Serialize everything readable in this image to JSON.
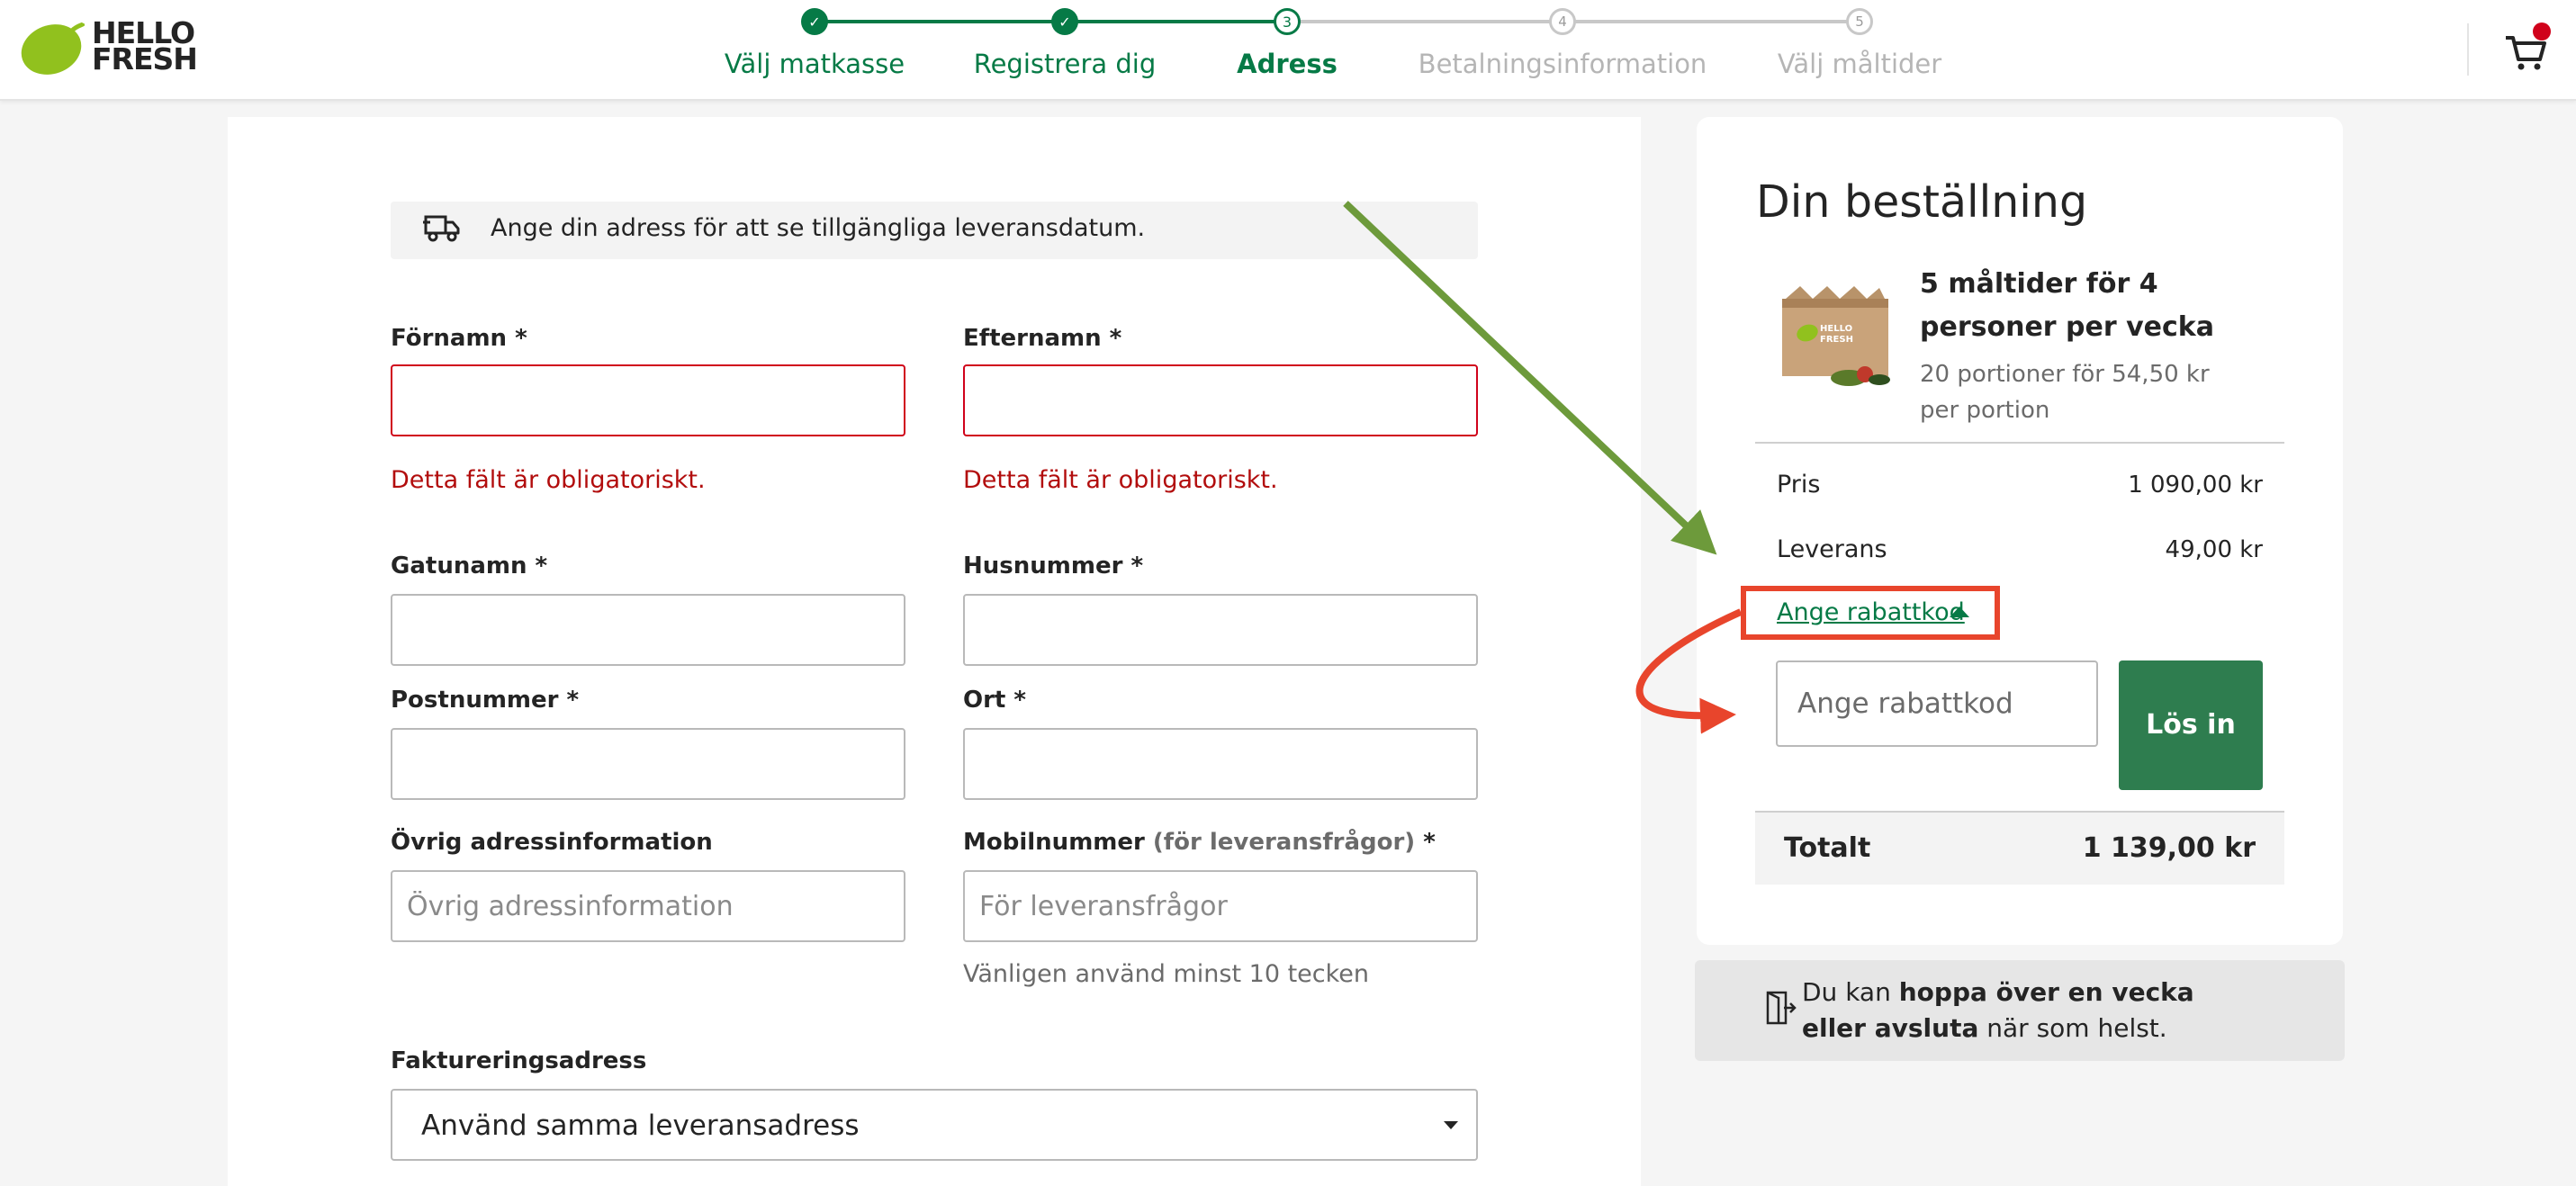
{
  "header": {
    "logo_text_line1": "HELLO",
    "logo_text_line2": "FRESH",
    "steps": [
      {
        "number": "1",
        "label": "Välj matkasse",
        "state": "done"
      },
      {
        "number": "2",
        "label": "Registrera dig",
        "state": "done"
      },
      {
        "number": "3",
        "label": "Adress",
        "state": "current"
      },
      {
        "number": "4",
        "label": "Betalningsinformation",
        "state": "todo"
      },
      {
        "number": "5",
        "label": "Välj måltider",
        "state": "todo"
      }
    ],
    "cart_icon": "cart-icon",
    "cart_has_notification": true
  },
  "form": {
    "banner_text": "Ange din adress för att se tillgängliga leveransdatum.",
    "first_name": {
      "label": "Förnamn *",
      "value": "",
      "error": "Detta fält är obligatoriskt."
    },
    "last_name": {
      "label": "Efternamn *",
      "value": "",
      "error": "Detta fält är obligatoriskt."
    },
    "street": {
      "label": "Gatunamn *",
      "value": ""
    },
    "house_number": {
      "label": "Husnummer *",
      "value": ""
    },
    "postal_code": {
      "label": "Postnummer *",
      "value": ""
    },
    "city": {
      "label": "Ort *",
      "value": ""
    },
    "other_address": {
      "label": "Övrig adressinformation",
      "placeholder": "Övrig adressinformation",
      "value": ""
    },
    "mobile": {
      "label": "Mobilnummer",
      "label_note": "(för leveransfrågor)",
      "label_required": " *",
      "placeholder": "För leveransfrågor",
      "hint": "Vänligen använd minst 10 tecken",
      "value": ""
    },
    "billing": {
      "label": "Faktureringsadress",
      "selected": "Använd samma leveransadress"
    }
  },
  "order": {
    "title": "Din beställning",
    "product_name": "5 måltider för 4 personer per vecka",
    "product_sub": "20 portioner för 54,50 kr per portion",
    "price_label": "Pris",
    "price_value": "1 090,00 kr",
    "delivery_label": "Leverans",
    "delivery_value": "49,00 kr",
    "promo_link": "Ange rabattkod",
    "promo_placeholder": "Ange rabattkod",
    "redeem_label": "Lös in",
    "total_label": "Totalt",
    "total_value": "1 139,00 kr"
  },
  "skip_info": {
    "prefix": "Du kan ",
    "bold1": "hoppa över en vecka eller avsluta",
    "suffix": " när som helst."
  },
  "colors": {
    "brand_green": "#067a46",
    "logo_green": "#91c11e",
    "error_red": "#b20d0d",
    "annotation_red": "#e8452c",
    "annotation_green": "#6d9a3b"
  }
}
